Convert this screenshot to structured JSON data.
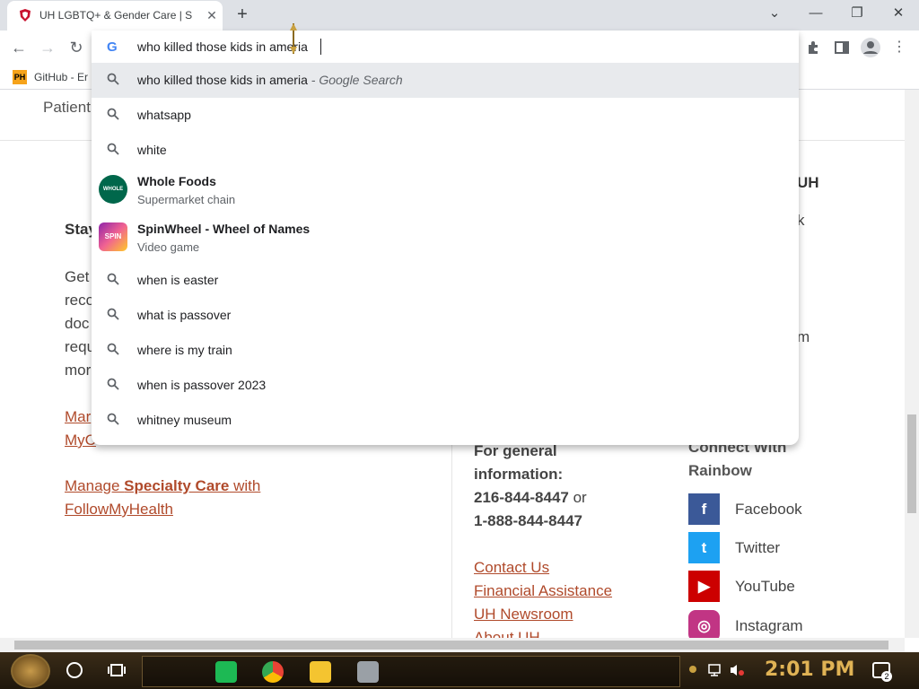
{
  "browser": {
    "tab_title": "UH LGBTQ+ & Gender Care | S",
    "tab_close": "✕",
    "new_tab": "+",
    "window": {
      "dropdown": "⌄",
      "minimize": "—",
      "restore": "❐",
      "close": "✕"
    },
    "nav": {
      "back": "←",
      "forward": "→",
      "reload": "↻"
    },
    "bookmark": {
      "label": "GitHub - Er",
      "icon_text": "PH"
    }
  },
  "omnibox": {
    "value": "who killed those kids in ameria",
    "suggestions": [
      {
        "type": "search",
        "text": "who killed those kids in ameria",
        "suffix": " - Google Search",
        "selected": true
      },
      {
        "type": "search",
        "text": "whatsapp"
      },
      {
        "type": "search",
        "text": "white"
      },
      {
        "type": "entity",
        "text": "Whole Foods",
        "subtitle": "Supermarket chain",
        "logo_text": "WHOLE FOODS"
      },
      {
        "type": "entity",
        "text": "SpinWheel - Wheel of Names",
        "subtitle": "Video game",
        "logo_text": "SPIN"
      },
      {
        "type": "search",
        "text": "when is easter"
      },
      {
        "type": "search",
        "text": "what is passover"
      },
      {
        "type": "search",
        "text": "where is my train"
      },
      {
        "type": "search",
        "text": "when is passover 2023"
      },
      {
        "type": "search",
        "text": "whitney museum"
      }
    ]
  },
  "page": {
    "nav_partial": "Patient",
    "left_partial": {
      "heading": "Stay",
      "lines": [
        "Get",
        "reco",
        "doc",
        "requ",
        "mor"
      ]
    },
    "right_partial": {
      "heading": "UH",
      "l1": "k",
      "l2": "m"
    },
    "links_left": {
      "mychart_line1": "Mar",
      "mychart_line2": "MyC",
      "specialty_1": "Manage ",
      "specialty_bold": "Specialty Care",
      "specialty_2": " with",
      "specialty_3": "FollowMyHealth"
    },
    "general": {
      "title_1": "For general",
      "title_2": "information:",
      "phone1": "216-844-8447",
      "or": " or",
      "phone2": "1-888-844-8447",
      "links": [
        "Contact Us",
        "Financial Assistance",
        "UH Newsroom",
        "About UH"
      ]
    },
    "connect": {
      "title_1": "Connect With",
      "title_2": "Rainbow",
      "items": [
        {
          "label": "Facebook",
          "color": "#3b5998",
          "glyph": "f"
        },
        {
          "label": "Twitter",
          "color": "#1da1f2",
          "glyph": "t"
        },
        {
          "label": "YouTube",
          "color": "#cc0000",
          "glyph": "▶"
        },
        {
          "label": "Instagram",
          "color": "#c13584",
          "glyph": "◎"
        }
      ]
    }
  },
  "taskbar": {
    "time": "2:01 PM",
    "notif_count": "2"
  }
}
